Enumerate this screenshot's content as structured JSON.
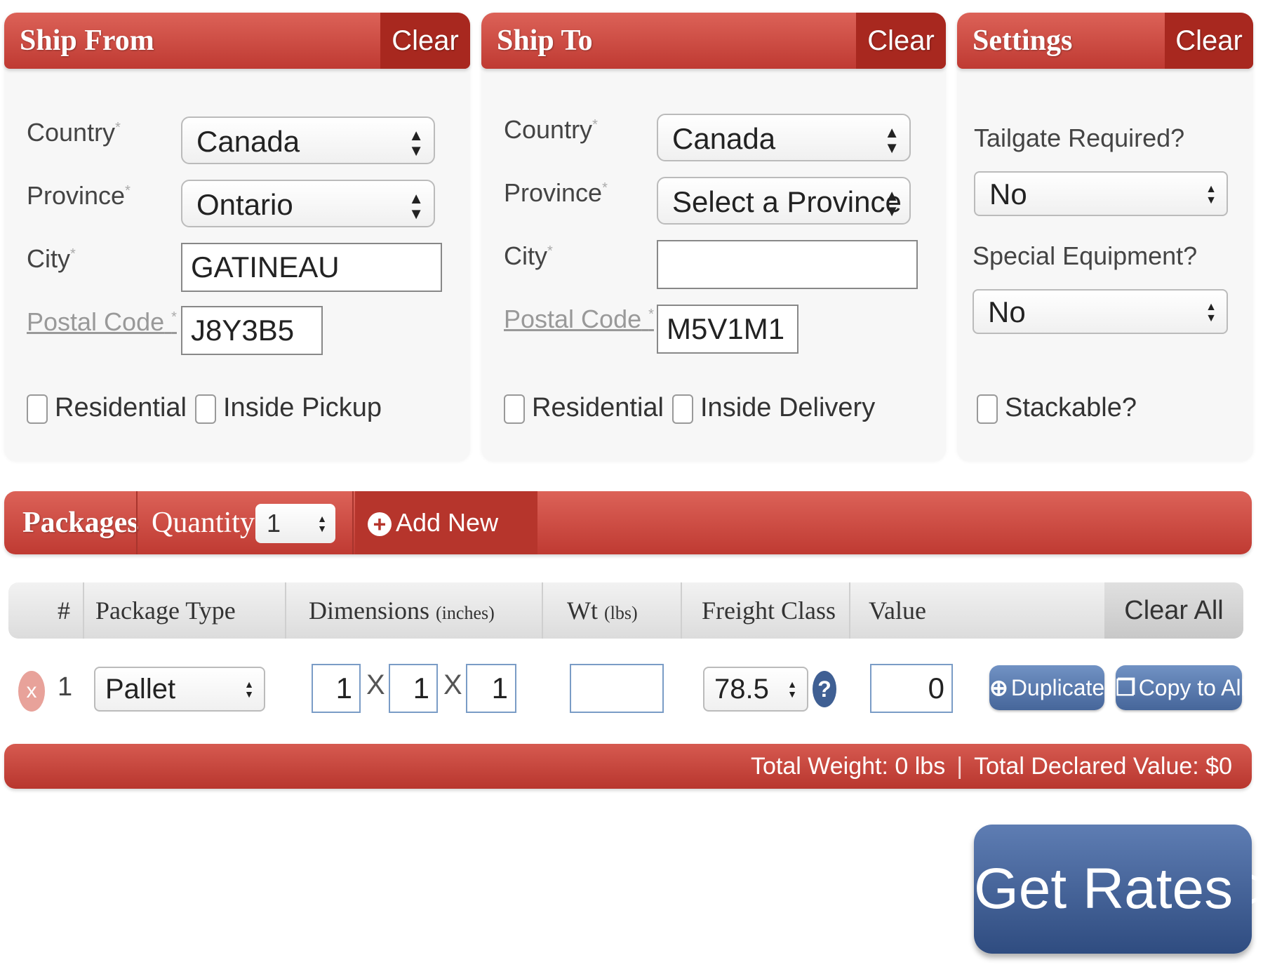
{
  "ship_from": {
    "title": "Ship From",
    "clear_label": "Clear",
    "country_label": "Country",
    "country_value": "Canada",
    "province_label": "Province",
    "province_value": "Ontario",
    "city_label": "City",
    "city_value": "GATINEAU",
    "postal_label": "Postal Code",
    "postal_value": "J8Y3B5",
    "required_mark": "*",
    "residential_label": "Residential",
    "inside_label": "Inside Pickup"
  },
  "ship_to": {
    "title": "Ship To",
    "clear_label": "Clear",
    "country_label": "Country",
    "country_value": "Canada",
    "province_label": "Province",
    "province_value": "Select a Province",
    "city_label": "City",
    "city_value": "",
    "postal_label": "Postal Code",
    "postal_value": "M5V1M1",
    "required_mark": "*",
    "residential_label": "Residential",
    "inside_label": "Inside Delivery"
  },
  "settings": {
    "title": "Settings",
    "clear_label": "Clear",
    "tailgate_label": "Tailgate Required?",
    "tailgate_value": "No",
    "equipment_label": "Special Equipment?",
    "equipment_value": "No",
    "stackable_label": "Stackable?"
  },
  "packages": {
    "title": "Packages",
    "quantity_label": "Quantity:",
    "quantity_value": "1",
    "add_label": "Add New Item",
    "columns": {
      "num": "#",
      "type": "Package Type",
      "dimensions": "Dimensions",
      "dimensions_unit": "(inches)",
      "weight": "Wt",
      "weight_unit": "(lbs)",
      "freight": "Freight Class",
      "value": "Value",
      "clear_all": "Clear All"
    },
    "rows": [
      {
        "num": "1",
        "remove": "x",
        "type": "Pallet",
        "length": "1",
        "width": "1",
        "height": "1",
        "x_sep": "X",
        "weight": "",
        "freight_class": "78.5",
        "help": "?",
        "value": "0",
        "duplicate_label": "Duplicate",
        "copy_label": "Copy to All"
      }
    ]
  },
  "totals": {
    "weight_text": "Total Weight: 0 lbs",
    "separator": "|",
    "value_text": "Total Declared Value: $0"
  },
  "get_rates_label": "Get Rates >>",
  "colors": {
    "header_red": "#c8453c",
    "button_blue": "#4a6aa0"
  }
}
